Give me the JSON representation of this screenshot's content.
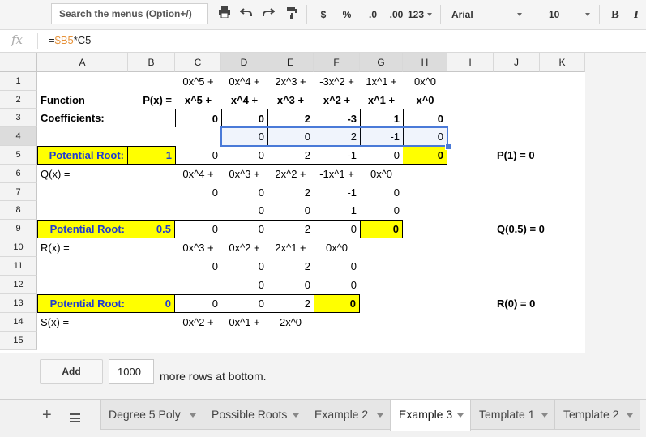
{
  "toolbar": {
    "search_placeholder": "Search the menus (Option+/)",
    "currency": "$",
    "percent": "%",
    "dec_less": ".0",
    "dec_more": ".00",
    "number_format": "123",
    "font": "Arial",
    "font_size": "10",
    "bold": "B",
    "italic": "I"
  },
  "formula_bar": {
    "fx": "fx",
    "prefix": "=",
    "ref": "$B5",
    "rest": "*C5"
  },
  "columns": [
    "A",
    "B",
    "C",
    "D",
    "E",
    "F",
    "G",
    "H",
    "I",
    "J",
    "K"
  ],
  "rows": [
    "1",
    "2",
    "3",
    "4",
    "5",
    "6",
    "7",
    "8",
    "9",
    "10",
    "11",
    "12",
    "13",
    "14",
    "15"
  ],
  "cells": {
    "C1": "0x^5 +",
    "D1": "0x^4 +",
    "E1": "2x^3 +",
    "F1": "-3x^2 +",
    "G1": "1x^1 +",
    "H1": "0x^0",
    "A2": "Function",
    "B2": "P(x) =",
    "C2": "x^5 +",
    "D2": "x^4 +",
    "E2": "x^3 +",
    "F2": "x^2 +",
    "G2": "x^1 +",
    "H2": "x^0",
    "A3": "Coefficients:",
    "C3": "0",
    "D3": "0",
    "E3": "2",
    "F3": "-3",
    "G3": "1",
    "H3": "0",
    "D4": "0",
    "E4": "0",
    "F4": "2",
    "G4": "-1",
    "H4": "0",
    "A5": "Potential Root:",
    "B5": "1",
    "C5": "0",
    "D5": "0",
    "E5": "2",
    "F5": "-1",
    "G5": "0",
    "H5": "0",
    "J5": "P(1) = 0",
    "A6": "Q(x) =",
    "C6": "0x^4 +",
    "D6": "0x^3 +",
    "E6": "2x^2 +",
    "F6": "-1x^1 +",
    "G6": "0x^0",
    "C7": "0",
    "D7": "0",
    "E7": "2",
    "F7": "-1",
    "G7": "0",
    "D8": "0",
    "E8": "0",
    "F8": "1",
    "G8": "0",
    "A9": "Potential Root:",
    "B9": "0.5",
    "C9": "0",
    "D9": "0",
    "E9": "2",
    "F9": "0",
    "G9": "0",
    "J9": "Q(0.5) = 0",
    "A10": "R(x) =",
    "C10": "0x^3 +",
    "D10": "0x^2 +",
    "E10": "2x^1 +",
    "F10": "0x^0",
    "C11": "0",
    "D11": "0",
    "E11": "2",
    "F11": "0",
    "D12": "0",
    "E12": "0",
    "F12": "0",
    "A13": "Potential Root:",
    "B13": "0",
    "C13": "0",
    "D13": "0",
    "E13": "2",
    "F13": "0",
    "J13": "R(0) = 0",
    "A14": "S(x) =",
    "C14": "0x^2 +",
    "D14": "0x^1 +",
    "E14": "2x^0"
  },
  "add_rows": {
    "button": "Add",
    "count": "1000",
    "suffix": "more rows at bottom."
  },
  "sheet_tabs": [
    {
      "label": "Degree 5 Poly"
    },
    {
      "label": "Possible Roots"
    },
    {
      "label": "Example 2"
    },
    {
      "label": "Example 3"
    },
    {
      "label": "Template 1"
    },
    {
      "label": "Template 2"
    }
  ],
  "colors": {
    "yellow": "#ffff00",
    "blue_text": "#1f3bd1",
    "selection": "#4a7ad8",
    "ref_color": "#e69138",
    "cell_ref_color": "#9900cc"
  }
}
